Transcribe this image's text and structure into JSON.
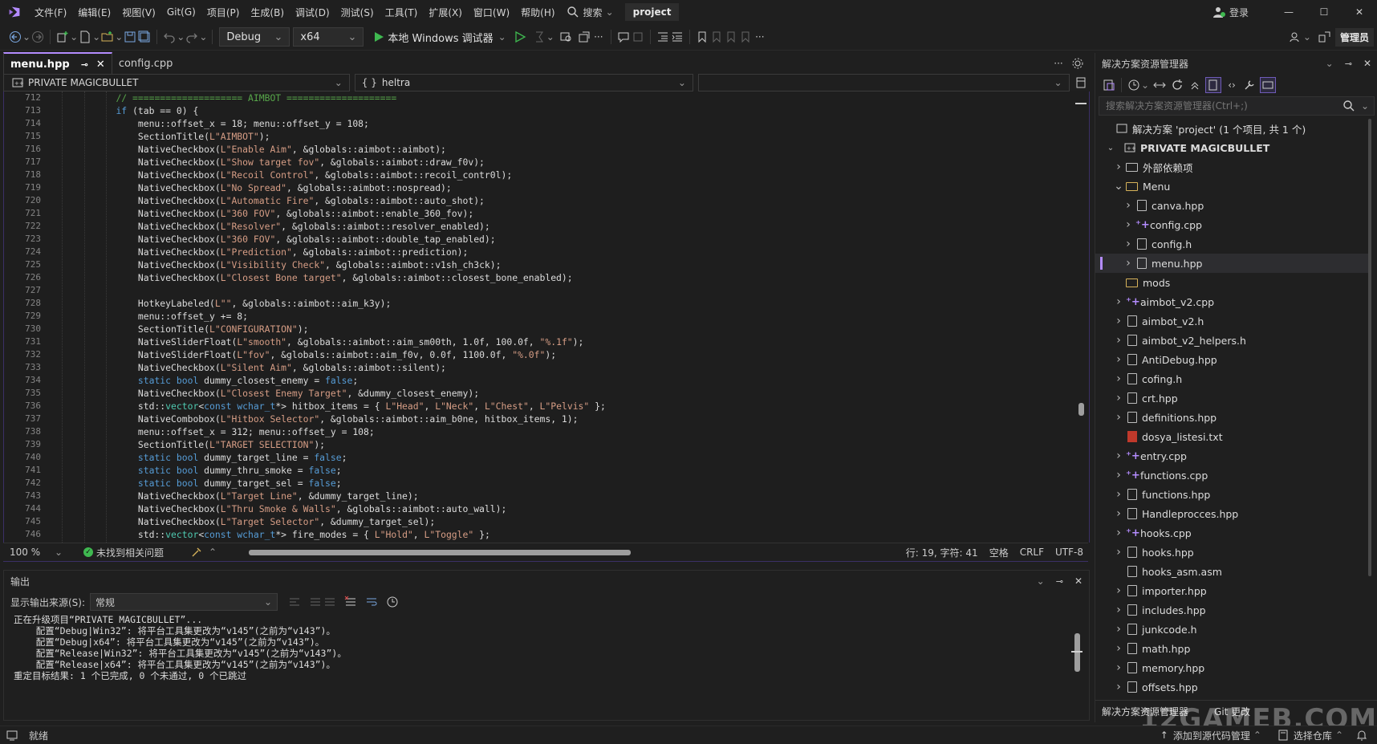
{
  "menu": [
    "文件(F)",
    "编辑(E)",
    "视图(V)",
    "Git(G)",
    "项目(P)",
    "生成(B)",
    "调试(D)",
    "测试(S)",
    "工具(T)",
    "扩展(X)",
    "窗口(W)",
    "帮助(H)"
  ],
  "search_label": "搜索",
  "project_name": "project",
  "login_label": "登录",
  "admin_label": "管理员",
  "toolbar": {
    "config": "Debug",
    "platform": "x64",
    "run_label": "本地 Windows 调试器"
  },
  "tabs": [
    {
      "label": "menu.hpp",
      "active": true
    },
    {
      "label": "config.cpp",
      "active": false
    }
  ],
  "nav": {
    "project": "PRIVATE MAGICBULLET",
    "scope": "heltra"
  },
  "code_lines": [
    {
      "n": "712",
      "html": "    <span class='cmt'>// ==================== AIMBOT ====================</span>"
    },
    {
      "n": "713",
      "html": "    <span class='kw'>if</span> (tab == 0) {"
    },
    {
      "n": "714",
      "html": "        menu::offset_x = 18; menu::offset_y = 108;"
    },
    {
      "n": "715",
      "html": "        SectionTitle(<span class='str'>L\"AIMBOT\"</span>);"
    },
    {
      "n": "716",
      "html": "        NativeCheckbox(<span class='str'>L\"Enable Aim\"</span>, &globals::aimbot::aimbot);"
    },
    {
      "n": "717",
      "html": "        NativeCheckbox(<span class='str'>L\"Show target fov\"</span>, &globals::aimbot::draw_f0v);"
    },
    {
      "n": "718",
      "html": "        NativeCheckbox(<span class='str'>L\"Recoil Control\"</span>, &globals::aimbot::recoil_contr0l);"
    },
    {
      "n": "719",
      "html": "        NativeCheckbox(<span class='str'>L\"No Spread\"</span>, &globals::aimbot::nospread);"
    },
    {
      "n": "720",
      "html": "        NativeCheckbox(<span class='str'>L\"Automatic Fire\"</span>, &globals::aimbot::auto_shot);"
    },
    {
      "n": "721",
      "html": "        NativeCheckbox(<span class='str'>L\"360 FOV\"</span>, &globals::aimbot::enable_360_fov);"
    },
    {
      "n": "722",
      "html": "        NativeCheckbox(<span class='str'>L\"Resolver\"</span>, &globals::aimbot::resolver_enabled);"
    },
    {
      "n": "723",
      "html": "        NativeCheckbox(<span class='str'>L\"360 FOV\"</span>, &globals::aimbot::double_tap_enabled);"
    },
    {
      "n": "724",
      "html": "        NativeCheckbox(<span class='str'>L\"Prediction\"</span>, &globals::aimbot::prediction);"
    },
    {
      "n": "725",
      "html": "        NativeCheckbox(<span class='str'>L\"Visibility Check\"</span>, &globals::aimbot::v1sh_ch3ck);"
    },
    {
      "n": "726",
      "html": "        NativeCheckbox(<span class='str'>L\"Closest Bone target\"</span>, &globals::aimbot::closest_bone_enabled);"
    },
    {
      "n": "727",
      "html": ""
    },
    {
      "n": "728",
      "html": "        HotkeyLabeled(<span class='str'>L\"\"</span>, &globals::aimbot::aim_k3y);"
    },
    {
      "n": "729",
      "html": "        menu::offset_y += 8;"
    },
    {
      "n": "730",
      "html": "        SectionTitle(<span class='str'>L\"CONFIGURATION\"</span>);"
    },
    {
      "n": "731",
      "html": "        NativeSliderFloat(<span class='str'>L\"smooth\"</span>, &globals::aimbot::aim_sm00th, 1.0f, 100.0f, <span class='str'>\"%.1f\"</span>);"
    },
    {
      "n": "732",
      "html": "        NativeSliderFloat(<span class='str'>L\"fov\"</span>, &globals::aimbot::aim_f0v, 0.0f, 1100.0f, <span class='str'>\"%.0f\"</span>);"
    },
    {
      "n": "733",
      "html": "        NativeCheckbox(<span class='str'>L\"Silent Aim\"</span>, &globals::aimbot::silent);"
    },
    {
      "n": "734",
      "html": "        <span class='kw'>static bool</span> dummy_closest_enemy = <span class='kw'>false</span>;"
    },
    {
      "n": "735",
      "html": "        NativeCheckbox(<span class='str'>L\"Closest Enemy Target\"</span>, &dummy_closest_enemy);"
    },
    {
      "n": "736",
      "html": "        std::<span class='typ'>vector</span>&lt;<span class='kw'>const wchar_t</span>*&gt; hitbox_items = { <span class='str'>L\"Head\"</span>, <span class='str'>L\"Neck\"</span>, <span class='str'>L\"Chest\"</span>, <span class='str'>L\"Pelvis\"</span> };"
    },
    {
      "n": "737",
      "html": "        NativeCombobox(<span class='str'>L\"Hitbox Selector\"</span>, &globals::aimbot::aim_b0ne, hitbox_items, 1);"
    },
    {
      "n": "738",
      "html": "        menu::offset_x = 312; menu::offset_y = 108;"
    },
    {
      "n": "739",
      "html": "        SectionTitle(<span class='str'>L\"TARGET SELECTION\"</span>);"
    },
    {
      "n": "740",
      "html": "        <span class='kw'>static bool</span> dummy_target_line = <span class='kw'>false</span>;"
    },
    {
      "n": "741",
      "html": "        <span class='kw'>static bool</span> dummy_thru_smoke = <span class='kw'>false</span>;"
    },
    {
      "n": "742",
      "html": "        <span class='kw'>static bool</span> dummy_target_sel = <span class='kw'>false</span>;"
    },
    {
      "n": "743",
      "html": "        NativeCheckbox(<span class='str'>L\"Target Line\"</span>, &dummy_target_line);"
    },
    {
      "n": "744",
      "html": "        NativeCheckbox(<span class='str'>L\"Thru Smoke & Walls\"</span>, &globals::aimbot::auto_wall);"
    },
    {
      "n": "745",
      "html": "        NativeCheckbox(<span class='str'>L\"Target Selector\"</span>, &dummy_target_sel);"
    },
    {
      "n": "746",
      "html": "        std::<span class='typ'>vector</span>&lt;<span class='kw'>const wchar_t</span>*&gt; fire_modes = { <span class='str'>L\"Hold\"</span>, <span class='str'>L\"Toggle\"</span> };"
    }
  ],
  "editor_status": {
    "zoom": "100 %",
    "issues": "未找到相关问题",
    "position": "行: 19, 字符: 41",
    "whitespace": "空格",
    "eol": "CRLF",
    "encoding": "UTF-8"
  },
  "output": {
    "title": "输出",
    "source_label": "显示输出来源(S):",
    "source_value": "常规",
    "lines": [
      "正在升级项目“PRIVATE MAGICBULLET”...",
      "    配置“Debug|Win32”: 将平台工具集更改为“v145”(之前为“v143”)。",
      "    配置“Debug|x64”: 将平台工具集更改为“v145”(之前为“v143”)。",
      "    配置“Release|Win32”: 将平台工具集更改为“v145”(之前为“v143”)。",
      "    配置“Release|x64”: 将平台工具集更改为“v145”(之前为“v143”)。",
      "重定目标结果: 1 个已完成, 0 个未通过, 0 个已跳过"
    ]
  },
  "solution": {
    "title": "解决方案资源管理器",
    "search_placeholder": "搜索解决方案资源管理器(Ctrl+;)",
    "solution_label": "解决方案 'project' (1 个项目, 共 1 个)",
    "project_label": "PRIVATE MAGICBULLET",
    "items": [
      {
        "label": "外部依赖项",
        "icon": "ext",
        "indent": 2,
        "chev": ">"
      },
      {
        "label": "Menu",
        "icon": "folder",
        "indent": 2,
        "chev": "v"
      },
      {
        "label": "canva.hpp",
        "icon": "file",
        "indent": 3,
        "chev": ">"
      },
      {
        "label": "config.cpp",
        "icon": "plus",
        "indent": 3,
        "chev": ">"
      },
      {
        "label": "config.h",
        "icon": "file",
        "indent": 3,
        "chev": ">"
      },
      {
        "label": "menu.hpp",
        "icon": "file",
        "indent": 3,
        "chev": ">",
        "selected": true
      },
      {
        "label": "mods",
        "icon": "folder",
        "indent": 2,
        "chev": ""
      },
      {
        "label": "aimbot_v2.cpp",
        "icon": "plus",
        "indent": 2,
        "chev": ">"
      },
      {
        "label": "aimbot_v2.h",
        "icon": "file",
        "indent": 2,
        "chev": ">"
      },
      {
        "label": "aimbot_v2_helpers.h",
        "icon": "file",
        "indent": 2,
        "chev": ">"
      },
      {
        "label": "AntiDebug.hpp",
        "icon": "file",
        "indent": 2,
        "chev": ">"
      },
      {
        "label": "cofing.h",
        "icon": "file",
        "indent": 2,
        "chev": ">"
      },
      {
        "label": "crt.hpp",
        "icon": "file",
        "indent": 2,
        "chev": ">"
      },
      {
        "label": "definitions.hpp",
        "icon": "file",
        "indent": 2,
        "chev": ">"
      },
      {
        "label": "dosya_listesi.txt",
        "icon": "txt",
        "indent": 2,
        "chev": ""
      },
      {
        "label": "entry.cpp",
        "icon": "plus",
        "indent": 2,
        "chev": ">"
      },
      {
        "label": "functions.cpp",
        "icon": "plus",
        "indent": 2,
        "chev": ">"
      },
      {
        "label": "functions.hpp",
        "icon": "file",
        "indent": 2,
        "chev": ">"
      },
      {
        "label": "Handleprocces.hpp",
        "icon": "file",
        "indent": 2,
        "chev": ">"
      },
      {
        "label": "hooks.cpp",
        "icon": "plus",
        "indent": 2,
        "chev": ">"
      },
      {
        "label": "hooks.hpp",
        "icon": "file",
        "indent": 2,
        "chev": ">"
      },
      {
        "label": "hooks_asm.asm",
        "icon": "file",
        "indent": 2,
        "chev": ""
      },
      {
        "label": "importer.hpp",
        "icon": "file",
        "indent": 2,
        "chev": ">"
      },
      {
        "label": "includes.hpp",
        "icon": "file",
        "indent": 2,
        "chev": ">"
      },
      {
        "label": "junkcode.h",
        "icon": "file",
        "indent": 2,
        "chev": ">"
      },
      {
        "label": "math.hpp",
        "icon": "file",
        "indent": 2,
        "chev": ">"
      },
      {
        "label": "memory.hpp",
        "icon": "file",
        "indent": 2,
        "chev": ">"
      },
      {
        "label": "offsets.hpp",
        "icon": "file",
        "indent": 2,
        "chev": ">"
      }
    ],
    "bottom_tab_1": "解决方案资源管理器",
    "bottom_tab_2": "Git 更改"
  },
  "statusbar": {
    "ready": "就绪",
    "add_source": "添加到源代码管理",
    "select_repo": "选择仓库"
  },
  "watermark": "12GAMEB.COM",
  "colors": {
    "accent": "#b48cff",
    "run_green": "#3fb950"
  }
}
